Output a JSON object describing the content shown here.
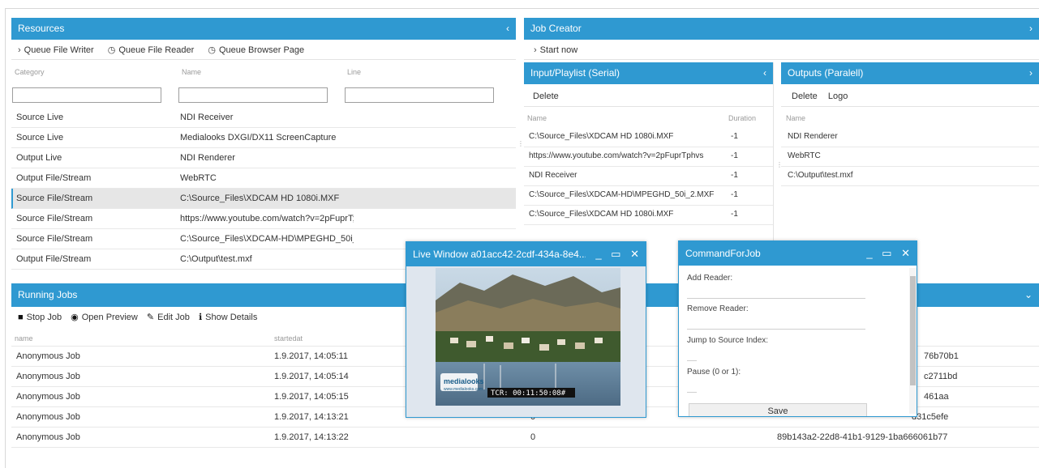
{
  "resources": {
    "title": "Resources",
    "collapse_icon": "‹",
    "toolbar": [
      {
        "icon": "›",
        "label": "Queue File Writer"
      },
      {
        "icon": "◷",
        "label": "Queue File Reader"
      },
      {
        "icon": "◷",
        "label": "Queue Browser Page"
      }
    ],
    "columns": [
      "Category",
      "Name",
      "Line"
    ],
    "rows": [
      {
        "category": "Source Live",
        "name": "NDI Receiver"
      },
      {
        "category": "Source Live",
        "name": "Medialooks DXGI/DX11 ScreenCapture"
      },
      {
        "category": "Output Live",
        "name": "NDI Renderer"
      },
      {
        "category": "Output File/Stream",
        "name": "WebRTC"
      },
      {
        "category": "Source File/Stream",
        "name": "C:\\Source_Files\\XDCAM HD 1080i.MXF"
      },
      {
        "category": "Source File/Stream",
        "name": "https://www.youtube.com/watch?v=2pFuprT;"
      },
      {
        "category": "Source File/Stream",
        "name": "C:\\Source_Files\\XDCAM-HD\\MPEGHD_50i_"
      },
      {
        "category": "Output File/Stream",
        "name": "C:\\Output\\test.mxf"
      }
    ]
  },
  "job_creator": {
    "title": "Job Creator",
    "collapse_icon": "›",
    "start_label": "Start now",
    "start_icon": "›"
  },
  "input_playlist": {
    "title": "Input/Playlist (Serial)",
    "collapse_icon": "‹",
    "delete_label": "Delete",
    "columns": [
      "Name",
      "Duration"
    ],
    "rows": [
      {
        "name": "C:\\Source_Files\\XDCAM HD 1080i.MXF",
        "duration": "-1"
      },
      {
        "name": "https://www.youtube.com/watch?v=2pFuprTphvs",
        "duration": "-1"
      },
      {
        "name": "NDI Receiver",
        "duration": "-1"
      },
      {
        "name": "C:\\Source_Files\\XDCAM-HD\\MPEGHD_50i_2.MXF",
        "duration": "-1"
      },
      {
        "name": "C:\\Source_Files\\XDCAM HD 1080i.MXF",
        "duration": "-1"
      }
    ]
  },
  "outputs": {
    "title": "Outputs (Paralell)",
    "collapse_icon": "›",
    "delete_label": "Delete",
    "logo_label": "Logo",
    "columns": [
      "Name"
    ],
    "rows": [
      "NDI Renderer",
      "WebRTC",
      "C:\\Output\\test.mxf"
    ]
  },
  "running_jobs": {
    "title": "Running Jobs",
    "collapse_icon": "⌄",
    "toolbar": [
      {
        "icon": "■",
        "label": "Stop Job"
      },
      {
        "icon": "◉",
        "label": "Open Preview"
      },
      {
        "icon": "✎",
        "label": "Edit Job"
      },
      {
        "icon": "ℹ",
        "label": "Show Details"
      }
    ],
    "columns": [
      "name",
      "startedat"
    ],
    "rows": [
      {
        "name": "Anonymous Job",
        "startedat": "1.9.2017, 14:05:11",
        "c3": "",
        "id": "76b70b1"
      },
      {
        "name": "Anonymous Job",
        "startedat": "1.9.2017, 14:05:14",
        "c3": "",
        "id": "c2711bd"
      },
      {
        "name": "Anonymous Job",
        "startedat": "1.9.2017, 14:05:15",
        "c3": "",
        "id": "461aa"
      },
      {
        "name": "Anonymous Job",
        "startedat": "1.9.2017, 14:13:21",
        "c3": "0",
        "id": "d31c5efe"
      },
      {
        "name": "Anonymous Job",
        "startedat": "1.9.2017, 14:13:22",
        "c3": "0",
        "id": "89b143a2-22d8-41b1-9129-1ba666061b77"
      }
    ]
  },
  "live_window": {
    "title": "Live Window a01acc42-2cdf-434a-8e4...",
    "minimize": "_",
    "maximize": "▭",
    "close": "✕",
    "logo_text": "medialooks",
    "logo_sub": "www.medialooks.com",
    "timecode": "TCR: 00:11:50:08#"
  },
  "command_window": {
    "title": "CommandForJob",
    "minimize": "_",
    "maximize": "▭",
    "close": "✕",
    "fields": [
      "Add Reader:",
      "Remove Reader:",
      "Jump to Source Index:",
      "Pause (0 or 1):"
    ],
    "save_label": "Save"
  },
  "colors": {
    "accent": "#2f99d1",
    "selected_row": "#e6e6e6",
    "border": "#e8e8e8"
  }
}
